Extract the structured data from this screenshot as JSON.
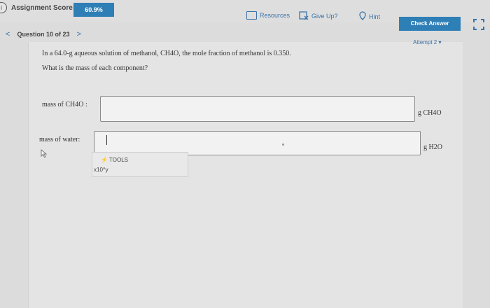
{
  "header": {
    "score_label": "Assignment Score:",
    "score_value": "60.9%",
    "resources_label": "Resources",
    "giveup_label": "Give Up?",
    "hint_label": "Hint",
    "check_label": "Check Answer"
  },
  "nav": {
    "prev": "<",
    "question": "Question 10 of 23",
    "next": ">",
    "attempt": "Attempt 2"
  },
  "question": {
    "line1": "In a 64.0-g aqueous solution of methanol, CH4O, the mole fraction of methanol is 0.350.",
    "line2": "What is the mass of each component?"
  },
  "fields": {
    "methanol_label": "mass of CH4O :",
    "methanol_unit": "g CH4O",
    "water_label": "mass of water:",
    "water_unit": "g H2O"
  },
  "tools": {
    "label": "TOOLS",
    "x10": "x10^y"
  }
}
